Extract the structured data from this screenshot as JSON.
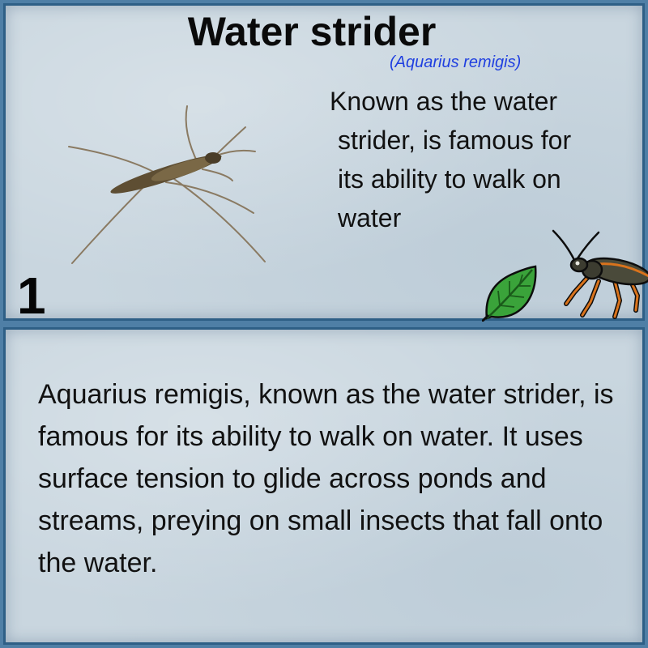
{
  "card": {
    "title": "Water strider",
    "scientific_name": "(Aquarius remigis)",
    "short_description_lines": [
      "Known as the water",
      "strider, is famous for",
      "its ability to walk on",
      "water"
    ],
    "number": "1",
    "long_description": "Aquarius remigis, known as the water strider, is famous for its ability to walk on water. It uses surface tension to glide across ponds and streams, preying on small insects that fall onto the water.",
    "icons": [
      "water-strider-photo",
      "leaf-icon",
      "insect-icon"
    ],
    "colors": {
      "frame": "#2e5f86",
      "background": "#c9d6df",
      "scientific_name": "#1f3fe0",
      "leaf": "#3aa33a",
      "insect_accent": "#d9731c"
    }
  }
}
